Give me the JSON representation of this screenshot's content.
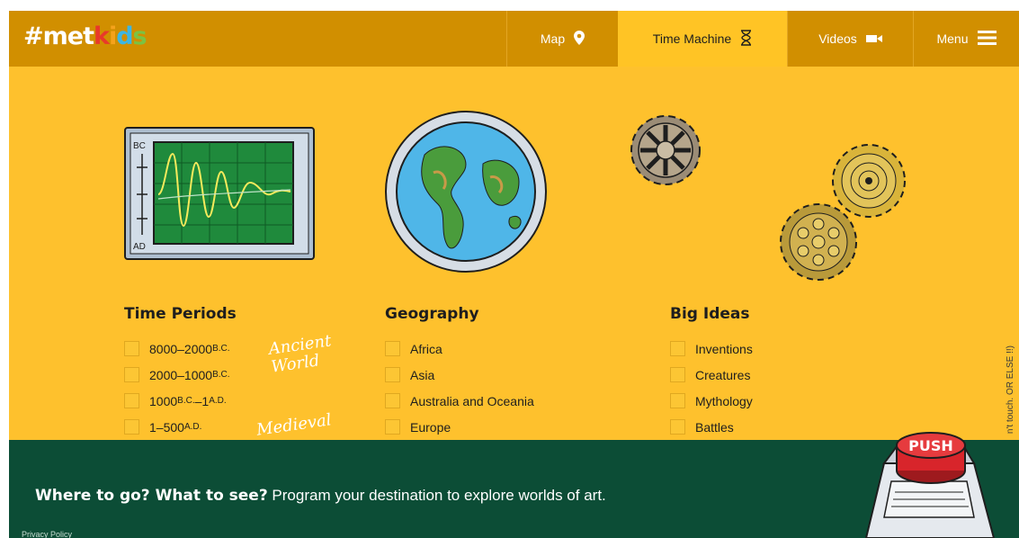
{
  "logo": {
    "hash": "#",
    "met": "met",
    "k": "k",
    "i": "i",
    "d": "d",
    "s": "s"
  },
  "nav": {
    "map": {
      "label": "Map",
      "icon": "map-pin-icon"
    },
    "time_machine": {
      "label": "Time Machine",
      "icon": "hourglass-icon"
    },
    "videos": {
      "label": "Videos",
      "icon": "video-camera-icon"
    },
    "menu": {
      "label": "Menu",
      "icon": "hamburger-icon"
    }
  },
  "monitor": {
    "top_label": "BC",
    "bottom_label": "AD"
  },
  "time_periods": {
    "heading": "Time Periods",
    "items": [
      {
        "num": "8000–2000 ",
        "era": "B.C."
      },
      {
        "num": "2000–1000 ",
        "era": "B.C."
      },
      {
        "num": "1000 ",
        "era": "B.C.",
        "rest": "–1 ",
        "era2": "A.D."
      },
      {
        "num": "1–500 ",
        "era": "A.D."
      }
    ],
    "annotation_1": "Ancient\nWorld",
    "annotation_2": "Medieval"
  },
  "geography": {
    "heading": "Geography",
    "items": [
      "Africa",
      "Asia",
      "Australia and Oceania",
      "Europe"
    ]
  },
  "big_ideas": {
    "heading": "Big Ideas",
    "items": [
      "Inventions",
      "Creatures",
      "Mythology",
      "Battles"
    ]
  },
  "side_note": "n't touch. OR ELSE !!)",
  "push_button": {
    "label": "PUSH"
  },
  "footer": {
    "tagline_bold": "Where to go? What to see?",
    "tagline_rest": " Program your destination to explore worlds of art.",
    "privacy": "Privacy Policy"
  },
  "colors": {
    "header": "#d18f00",
    "active_tab": "#ffc425",
    "main": "#fec12d",
    "footer": "#0c4d36",
    "push_red": "#d8252b"
  }
}
